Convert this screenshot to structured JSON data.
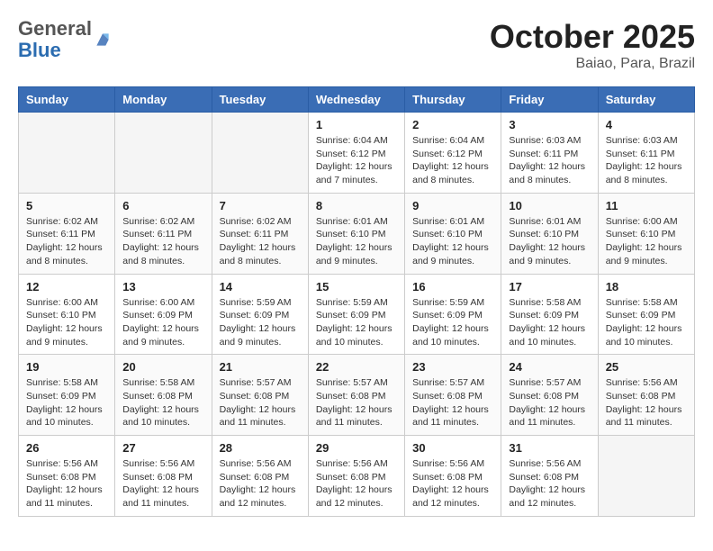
{
  "header": {
    "logo_general": "General",
    "logo_blue": "Blue",
    "month_title": "October 2025",
    "location": "Baiao, Para, Brazil"
  },
  "days_of_week": [
    "Sunday",
    "Monday",
    "Tuesday",
    "Wednesday",
    "Thursday",
    "Friday",
    "Saturday"
  ],
  "weeks": [
    [
      {
        "day": "",
        "info": ""
      },
      {
        "day": "",
        "info": ""
      },
      {
        "day": "",
        "info": ""
      },
      {
        "day": "1",
        "info": "Sunrise: 6:04 AM\nSunset: 6:12 PM\nDaylight: 12 hours\nand 7 minutes."
      },
      {
        "day": "2",
        "info": "Sunrise: 6:04 AM\nSunset: 6:12 PM\nDaylight: 12 hours\nand 8 minutes."
      },
      {
        "day": "3",
        "info": "Sunrise: 6:03 AM\nSunset: 6:11 PM\nDaylight: 12 hours\nand 8 minutes."
      },
      {
        "day": "4",
        "info": "Sunrise: 6:03 AM\nSunset: 6:11 PM\nDaylight: 12 hours\nand 8 minutes."
      }
    ],
    [
      {
        "day": "5",
        "info": "Sunrise: 6:02 AM\nSunset: 6:11 PM\nDaylight: 12 hours\nand 8 minutes."
      },
      {
        "day": "6",
        "info": "Sunrise: 6:02 AM\nSunset: 6:11 PM\nDaylight: 12 hours\nand 8 minutes."
      },
      {
        "day": "7",
        "info": "Sunrise: 6:02 AM\nSunset: 6:11 PM\nDaylight: 12 hours\nand 8 minutes."
      },
      {
        "day": "8",
        "info": "Sunrise: 6:01 AM\nSunset: 6:10 PM\nDaylight: 12 hours\nand 9 minutes."
      },
      {
        "day": "9",
        "info": "Sunrise: 6:01 AM\nSunset: 6:10 PM\nDaylight: 12 hours\nand 9 minutes."
      },
      {
        "day": "10",
        "info": "Sunrise: 6:01 AM\nSunset: 6:10 PM\nDaylight: 12 hours\nand 9 minutes."
      },
      {
        "day": "11",
        "info": "Sunrise: 6:00 AM\nSunset: 6:10 PM\nDaylight: 12 hours\nand 9 minutes."
      }
    ],
    [
      {
        "day": "12",
        "info": "Sunrise: 6:00 AM\nSunset: 6:10 PM\nDaylight: 12 hours\nand 9 minutes."
      },
      {
        "day": "13",
        "info": "Sunrise: 6:00 AM\nSunset: 6:09 PM\nDaylight: 12 hours\nand 9 minutes."
      },
      {
        "day": "14",
        "info": "Sunrise: 5:59 AM\nSunset: 6:09 PM\nDaylight: 12 hours\nand 9 minutes."
      },
      {
        "day": "15",
        "info": "Sunrise: 5:59 AM\nSunset: 6:09 PM\nDaylight: 12 hours\nand 10 minutes."
      },
      {
        "day": "16",
        "info": "Sunrise: 5:59 AM\nSunset: 6:09 PM\nDaylight: 12 hours\nand 10 minutes."
      },
      {
        "day": "17",
        "info": "Sunrise: 5:58 AM\nSunset: 6:09 PM\nDaylight: 12 hours\nand 10 minutes."
      },
      {
        "day": "18",
        "info": "Sunrise: 5:58 AM\nSunset: 6:09 PM\nDaylight: 12 hours\nand 10 minutes."
      }
    ],
    [
      {
        "day": "19",
        "info": "Sunrise: 5:58 AM\nSunset: 6:09 PM\nDaylight: 12 hours\nand 10 minutes."
      },
      {
        "day": "20",
        "info": "Sunrise: 5:58 AM\nSunset: 6:08 PM\nDaylight: 12 hours\nand 10 minutes."
      },
      {
        "day": "21",
        "info": "Sunrise: 5:57 AM\nSunset: 6:08 PM\nDaylight: 12 hours\nand 11 minutes."
      },
      {
        "day": "22",
        "info": "Sunrise: 5:57 AM\nSunset: 6:08 PM\nDaylight: 12 hours\nand 11 minutes."
      },
      {
        "day": "23",
        "info": "Sunrise: 5:57 AM\nSunset: 6:08 PM\nDaylight: 12 hours\nand 11 minutes."
      },
      {
        "day": "24",
        "info": "Sunrise: 5:57 AM\nSunset: 6:08 PM\nDaylight: 12 hours\nand 11 minutes."
      },
      {
        "day": "25",
        "info": "Sunrise: 5:56 AM\nSunset: 6:08 PM\nDaylight: 12 hours\nand 11 minutes."
      }
    ],
    [
      {
        "day": "26",
        "info": "Sunrise: 5:56 AM\nSunset: 6:08 PM\nDaylight: 12 hours\nand 11 minutes."
      },
      {
        "day": "27",
        "info": "Sunrise: 5:56 AM\nSunset: 6:08 PM\nDaylight: 12 hours\nand 11 minutes."
      },
      {
        "day": "28",
        "info": "Sunrise: 5:56 AM\nSunset: 6:08 PM\nDaylight: 12 hours\nand 12 minutes."
      },
      {
        "day": "29",
        "info": "Sunrise: 5:56 AM\nSunset: 6:08 PM\nDaylight: 12 hours\nand 12 minutes."
      },
      {
        "day": "30",
        "info": "Sunrise: 5:56 AM\nSunset: 6:08 PM\nDaylight: 12 hours\nand 12 minutes."
      },
      {
        "day": "31",
        "info": "Sunrise: 5:56 AM\nSunset: 6:08 PM\nDaylight: 12 hours\nand 12 minutes."
      },
      {
        "day": "",
        "info": ""
      }
    ]
  ]
}
